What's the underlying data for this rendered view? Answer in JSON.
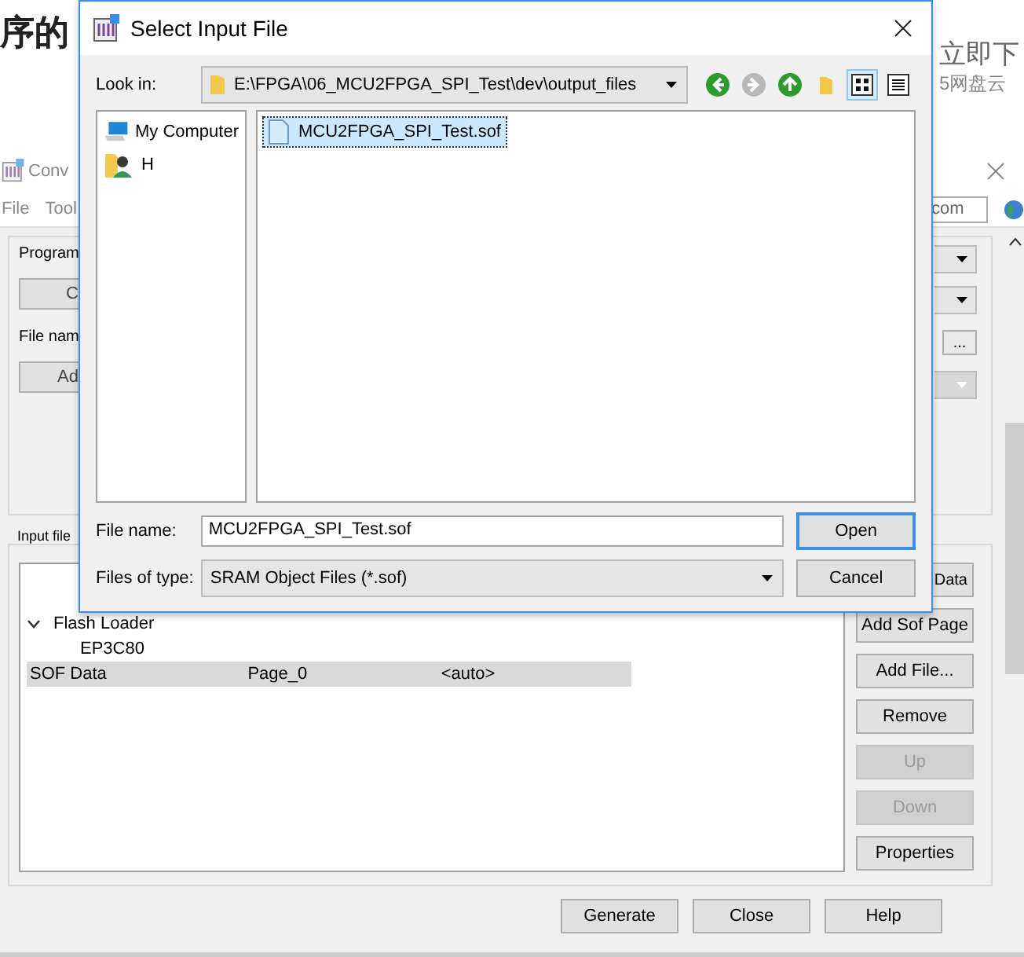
{
  "background_page": {
    "heading": "序的",
    "side_texts": [
      "立即下",
      "5网盘云"
    ]
  },
  "convert_window": {
    "title": "Conv",
    "menu": [
      "File",
      "Tool"
    ],
    "search_field": {
      "value": "com"
    },
    "program_group": {
      "label": "Program",
      "button": "C",
      "file_name_label": "File nam",
      "add_button": "Ad",
      "browse_button": "...",
      "dropdowns": [
        {
          "disabled": false
        },
        {
          "disabled": false
        },
        {
          "disabled": true
        }
      ]
    },
    "input_files": {
      "label": "Input file",
      "tree": [
        {
          "cells": [
            "Flash Loader"
          ],
          "selected": false,
          "expanded": true,
          "children": [
            {
              "cells": [
                "EP3C80"
              ],
              "selected": false
            }
          ]
        },
        {
          "cells": [
            "SOF Data",
            "Page_0",
            "<auto>"
          ],
          "selected": true
        }
      ],
      "buttons": [
        {
          "label": "Data",
          "disabled": false
        },
        {
          "label": "Add Sof Page",
          "disabled": false
        },
        {
          "label": "Add File...",
          "disabled": false
        },
        {
          "label": "Remove",
          "disabled": false
        },
        {
          "label": "Up",
          "disabled": true
        },
        {
          "label": "Down",
          "disabled": true
        },
        {
          "label": "Properties",
          "disabled": false
        }
      ]
    },
    "footer_buttons": [
      "Generate",
      "Close",
      "Help"
    ]
  },
  "dialog": {
    "title": "Select Input File",
    "look_in_label": "Look in:",
    "look_in_value": "E:\\FPGA\\06_MCU2FPGA_SPI_Test\\dev\\output_files",
    "nav_buttons": [
      {
        "kind": "back",
        "disabled": false
      },
      {
        "kind": "forward",
        "disabled": true
      },
      {
        "kind": "up",
        "disabled": false
      },
      {
        "kind": "new_folder",
        "disabled": false
      }
    ],
    "view_buttons": [
      {
        "kind": "icons",
        "selected": true
      },
      {
        "kind": "details",
        "selected": false
      }
    ],
    "places": [
      {
        "label": "My Computer",
        "kind": "computer"
      },
      {
        "label": "H",
        "kind": "user"
      }
    ],
    "files": [
      {
        "name": "MCU2FPGA_SPI_Test.sof",
        "selected": true
      }
    ],
    "file_name_label": "File name:",
    "file_name_value": "MCU2FPGA_SPI_Test.sof",
    "file_type_label": "Files of type:",
    "file_type_value": "SRAM Object Files (*.sof)",
    "buttons": [
      {
        "label": "Open",
        "default": true
      },
      {
        "label": "Cancel",
        "default": false
      }
    ]
  }
}
